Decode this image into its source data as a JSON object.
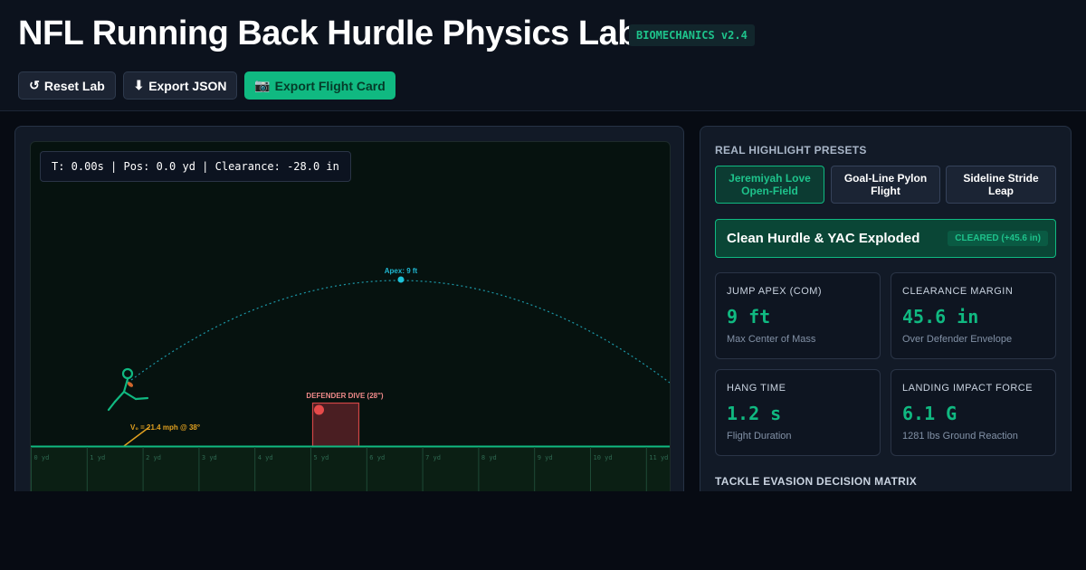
{
  "header": {
    "title": "NFL Running Back Hurdle Physics Lab",
    "badge": "BIOMECHANICS v2.4",
    "buttons": {
      "reset": {
        "icon": "↺",
        "label": "Reset Lab"
      },
      "export_json": {
        "icon": "⬇",
        "label": "Export JSON"
      },
      "export_card": {
        "icon": "📷",
        "label": "Export Flight Card"
      }
    }
  },
  "simulation": {
    "readout": "T: 0.00s | Pos: 0.0 yd | Clearance: -28.0 in",
    "apex_label": "Apex: 9 ft",
    "defender_label": "DEFENDER DIVE (28\")",
    "velocity_label": "V₀ = 21.4 mph @ 38°",
    "yard_labels": [
      "0 yd",
      "1 yd",
      "2 yd",
      "3 yd",
      "4 yd",
      "5 yd",
      "6 yd",
      "7 yd",
      "8 yd",
      "9 yd",
      "10 yd",
      "11 yd"
    ],
    "colors": {
      "turf": "#10b981",
      "trajectory": "#1fa6b8",
      "defender": "#d04545",
      "velocity": "#e0a020"
    }
  },
  "sidebar": {
    "presets_heading": "REAL HIGHLIGHT PRESETS",
    "presets": [
      {
        "line1": "Jeremiyah Love",
        "line2": "Open-Field",
        "active": true
      },
      {
        "line1": "Goal-Line Pylon",
        "line2": "Flight",
        "active": false
      },
      {
        "line1": "Sideline Stride",
        "line2": "Leap",
        "active": false
      }
    ],
    "status": {
      "title": "Clean Hurdle & YAC Exploded",
      "badge": "CLEARED (+45.6 in)"
    },
    "metrics": [
      {
        "label": "JUMP APEX (COM)",
        "value": "9 ft",
        "sub": "Max Center of Mass"
      },
      {
        "label": "CLEARANCE MARGIN",
        "value": "45.6 in",
        "sub": "Over Defender Envelope"
      },
      {
        "label": "HANG TIME",
        "value": "1.2 s",
        "sub": "Flight Duration"
      },
      {
        "label": "LANDING IMPACT FORCE",
        "value": "6.1 G",
        "sub": "1281 lbs Ground Reaction"
      }
    ],
    "matrix_heading": "TACKLE EVASION DECISION MATRIX"
  }
}
